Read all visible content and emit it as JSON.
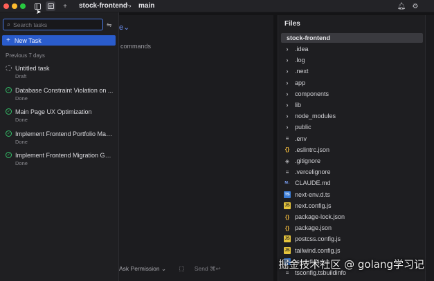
{
  "window": {
    "title": "stock-frontend",
    "branch": "main"
  },
  "colors": {
    "accent": "#2a5ccc",
    "done": "#34c26a",
    "close": "#ff5f57",
    "minimize": "#febc2e",
    "zoom": "#28c840"
  },
  "sidebar": {
    "search_placeholder": "Search tasks",
    "new_task_label": "New Task",
    "section_label": "Previous 7 days",
    "tasks": [
      {
        "title": "Untitled task",
        "status": "Draft"
      },
      {
        "title": "Database Constraint Violation on ...",
        "status": "Done"
      },
      {
        "title": "Main Page UX Optimization",
        "status": "Done"
      },
      {
        "title": "Implement Frontend Portfolio Man...",
        "status": "Done"
      },
      {
        "title": "Implement Frontend Migration Gui...",
        "status": "Done"
      }
    ]
  },
  "main": {
    "peek_chevron": "e",
    "peek_text": "commands",
    "permission_label": "Ask Permission",
    "send_label": "Send ⌘↩"
  },
  "files": {
    "title": "Files",
    "root": "stock-frontend",
    "items": [
      {
        "name": ".idea",
        "type": "folder"
      },
      {
        "name": ".log",
        "type": "folder"
      },
      {
        "name": ".next",
        "type": "folder"
      },
      {
        "name": "app",
        "type": "folder"
      },
      {
        "name": "components",
        "type": "folder"
      },
      {
        "name": "lib",
        "type": "folder"
      },
      {
        "name": "node_modules",
        "type": "folder"
      },
      {
        "name": "public",
        "type": "folder"
      },
      {
        "name": ".env",
        "type": "lines"
      },
      {
        "name": ".eslintrc.json",
        "type": "json"
      },
      {
        "name": ".gitignore",
        "type": "git"
      },
      {
        "name": ".vercelignore",
        "type": "lines"
      },
      {
        "name": "CLAUDE.md",
        "type": "md"
      },
      {
        "name": "next-env.d.ts",
        "type": "ts"
      },
      {
        "name": "next.config.js",
        "type": "js"
      },
      {
        "name": "package-lock.json",
        "type": "json"
      },
      {
        "name": "package.json",
        "type": "json"
      },
      {
        "name": "postcss.config.js",
        "type": "js"
      },
      {
        "name": "tailwind.config.js",
        "type": "js"
      },
      {
        "name": "tsconfig.json",
        "type": "ts"
      },
      {
        "name": "tsconfig.tsbuildinfo",
        "type": "lines"
      }
    ]
  },
  "watermark": "掘金技术社区 @ golang学习记"
}
